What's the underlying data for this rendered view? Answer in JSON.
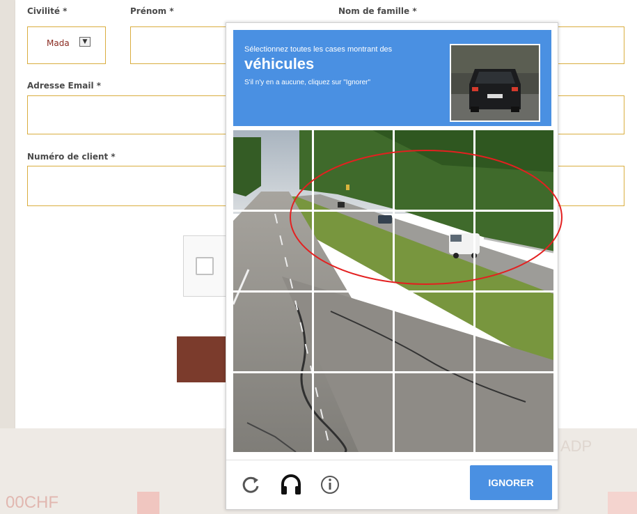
{
  "form": {
    "civility_label": "Civilité *",
    "civility_value": "Mada",
    "firstname_label": "Prénom *",
    "lastname_label": "Nom de famille *",
    "email_label": "Adresse Email *",
    "client_number_label": "Numéro de client *"
  },
  "footer": {
    "price_left": "00CHF",
    "adp_text": "ADP"
  },
  "recaptcha": {
    "instruction": "Sélectionnez toutes les cases montrant des",
    "keyword": "véhicules",
    "hint": "S'il n'y en a aucune, cliquez sur \"Ignorer\"",
    "skip_button": "IGNORER",
    "icons": [
      "reload-icon",
      "headphones-icon",
      "info-icon"
    ],
    "grid_rows": 4,
    "grid_cols": 4
  },
  "colors": {
    "accent_blue": "#4a90e2",
    "input_border": "#d9ad3e",
    "annotation_red": "#e32020",
    "submit_brown": "#7b3b2c"
  }
}
